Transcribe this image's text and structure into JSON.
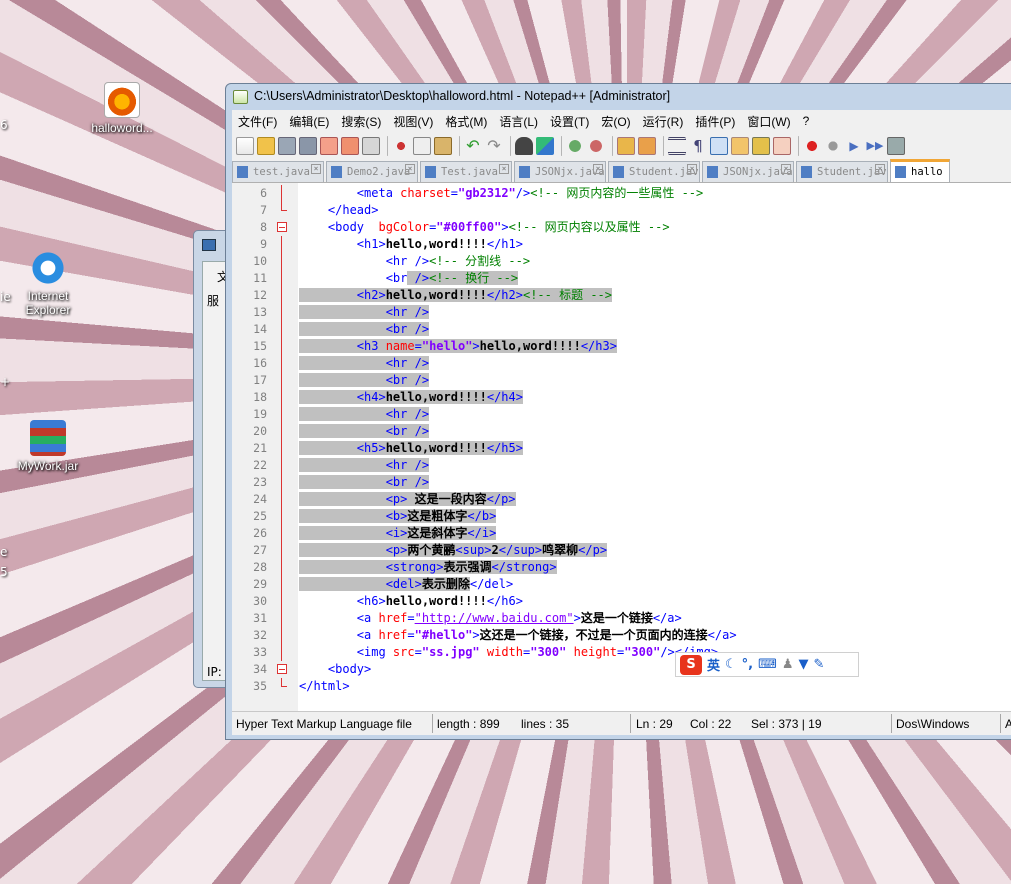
{
  "desktop": {
    "icons": [
      {
        "label": "halloword...",
        "icon": "firefox-html-file-icon"
      },
      {
        "label": "Internet Explorer",
        "icon": "internet-explorer-icon"
      },
      {
        "label": "MyWork.jar",
        "icon": "winrar-archive-icon"
      }
    ],
    "edge_glyphs": [
      "6",
      "ie",
      "+",
      "e",
      "5"
    ]
  },
  "background_window": {
    "chars": [
      "文",
      "服",
      "IP:"
    ]
  },
  "window": {
    "title": "C:\\Users\\Administrator\\Desktop\\halloword.html - Notepad++ [Administrator]"
  },
  "menu": [
    "文件(F)",
    "编辑(E)",
    "搜索(S)",
    "视图(V)",
    "格式(M)",
    "语言(L)",
    "设置(T)",
    "宏(O)",
    "运行(R)",
    "插件(P)",
    "窗口(W)",
    "?"
  ],
  "tabs": [
    {
      "label": "test.java",
      "active": false
    },
    {
      "label": "Demo2.java",
      "active": false
    },
    {
      "label": "Test.java",
      "active": false
    },
    {
      "label": "JSONjx.java",
      "active": false
    },
    {
      "label": "Student.java",
      "active": false
    },
    {
      "label": "JSONjx.java",
      "active": false
    },
    {
      "label": "Student.java",
      "active": false
    },
    {
      "label": "hallo",
      "active": true
    }
  ],
  "code_lines": [
    {
      "n": "6",
      "indent": "        ",
      "sel": false,
      "fold": "line",
      "html": "<span class='t-tag'>&lt;meta </span><span class='t-attr'>charset</span><span class='t-tag'>=</span><span class='t-val'>\"gb2312\"</span><span class='t-tag'>/&gt;</span><span class='t-com'>&lt;!-- 网页内容的一些属性 --&gt;</span>"
    },
    {
      "n": "7",
      "indent": "    ",
      "sel": false,
      "fold": "end",
      "html": "<span class='t-tag'>&lt;/head&gt;</span>"
    },
    {
      "n": "8",
      "indent": "    ",
      "sel": false,
      "fold": "box",
      "html": "<span class='t-tag'>&lt;body  </span><span class='t-attr'>bgColor</span><span class='t-tag'>=</span><span class='t-val'>\"#00ff00\"</span><span class='t-tag'>&gt;</span><span class='t-com'>&lt;!-- 网页内容以及属性 --&gt;</span>"
    },
    {
      "n": "9",
      "indent": "        ",
      "sel": false,
      "fold": "line",
      "html": "<span class='t-tag'>&lt;h1&gt;</span><span class='t-txt'>hello,word!!!!</span><span class='t-tag'>&lt;/h1&gt;</span>"
    },
    {
      "n": "10",
      "indent": "            ",
      "sel": false,
      "fold": "line",
      "html": "<span class='t-tag'>&lt;hr /&gt;</span><span class='t-com'>&lt;!-- 分割线 --&gt;</span>"
    },
    {
      "n": "11",
      "indent": "            ",
      "sel": "partial",
      "fold": "line",
      "pre": "<span class='t-tag'>&lt;br</span>",
      "html": "<span class='t-tag'> /&gt;</span><span class='t-com'>&lt;!-- 换行 --&gt;</span>"
    },
    {
      "n": "12",
      "indent": "        ",
      "sel": true,
      "fold": "line",
      "html": "<span class='t-tag'>&lt;h2&gt;</span><span class='t-txt'>hello,word!!!!</span><span class='t-tag'>&lt;/h2&gt;</span><span class='t-com'>&lt;!-- 标题 --&gt;</span>"
    },
    {
      "n": "13",
      "indent": "            ",
      "sel": true,
      "fold": "line",
      "html": "<span class='t-tag'>&lt;hr /&gt;</span>"
    },
    {
      "n": "14",
      "indent": "            ",
      "sel": true,
      "fold": "line",
      "html": "<span class='t-tag'>&lt;br /&gt;</span>"
    },
    {
      "n": "15",
      "indent": "        ",
      "sel": true,
      "fold": "line",
      "html": "<span class='t-tag'>&lt;h3 </span><span class='t-attr'>name</span><span class='t-tag'>=</span><span class='t-val'>\"hello\"</span><span class='t-tag'>&gt;</span><span class='t-txt'>hello,word!!!!</span><span class='t-tag'>&lt;/h3&gt;</span>"
    },
    {
      "n": "16",
      "indent": "            ",
      "sel": true,
      "fold": "line",
      "html": "<span class='t-tag'>&lt;hr /&gt;</span>"
    },
    {
      "n": "17",
      "indent": "            ",
      "sel": true,
      "fold": "line",
      "html": "<span class='t-tag'>&lt;br /&gt;</span>"
    },
    {
      "n": "18",
      "indent": "        ",
      "sel": true,
      "fold": "line",
      "html": "<span class='t-tag'>&lt;h4&gt;</span><span class='t-txt'>hello,word!!!!</span><span class='t-tag'>&lt;/h4&gt;</span>"
    },
    {
      "n": "19",
      "indent": "            ",
      "sel": true,
      "fold": "line",
      "html": "<span class='t-tag'>&lt;hr /&gt;</span>"
    },
    {
      "n": "20",
      "indent": "            ",
      "sel": true,
      "fold": "line",
      "html": "<span class='t-tag'>&lt;br /&gt;</span>"
    },
    {
      "n": "21",
      "indent": "        ",
      "sel": true,
      "fold": "line",
      "html": "<span class='t-tag'>&lt;h5&gt;</span><span class='t-txt'>hello,word!!!!</span><span class='t-tag'>&lt;/h5&gt;</span>"
    },
    {
      "n": "22",
      "indent": "            ",
      "sel": true,
      "fold": "line",
      "html": "<span class='t-tag'>&lt;hr /&gt;</span>"
    },
    {
      "n": "23",
      "indent": "            ",
      "sel": true,
      "fold": "line",
      "html": "<span class='t-tag'>&lt;br /&gt;</span>"
    },
    {
      "n": "24",
      "indent": "            ",
      "sel": true,
      "fold": "line",
      "html": "<span class='t-tag'>&lt;p&gt;</span><span class='t-txt'> 这是一段内容</span><span class='t-tag'>&lt;/p&gt;</span>"
    },
    {
      "n": "25",
      "indent": "            ",
      "sel": true,
      "fold": "line",
      "html": "<span class='t-tag'>&lt;b&gt;</span><span class='t-txt'>这是粗体字</span><span class='t-tag'>&lt;/b&gt;</span>"
    },
    {
      "n": "26",
      "indent": "            ",
      "sel": true,
      "fold": "line",
      "html": "<span class='t-tag'>&lt;i&gt;</span><span class='t-txt'>这是斜体字</span><span class='t-tag'>&lt;/i&gt;</span>"
    },
    {
      "n": "27",
      "indent": "            ",
      "sel": true,
      "fold": "line",
      "html": "<span class='t-tag'>&lt;p&gt;</span><span class='t-txt'>两个黄鹂</span><span class='t-tag'>&lt;sup&gt;</span><span class='t-txt'>2</span><span class='t-tag'>&lt;/sup&gt;</span><span class='t-txt'>鸣翠柳</span><span class='t-tag'>&lt;/p&gt;</span>"
    },
    {
      "n": "28",
      "indent": "            ",
      "sel": true,
      "fold": "line",
      "html": "<span class='t-tag'>&lt;strong&gt;</span><span class='t-txt'>表示强调</span><span class='t-tag'>&lt;/strong&gt;</span>"
    },
    {
      "n": "29",
      "indent": "            ",
      "sel": "partial-end",
      "fold": "line",
      "pre": "<span class='t-tag'>&lt;del&gt;</span><span class='t-txt'>表示删除</span>",
      "html": "<span class='t-tag'>&lt;/del&gt;</span>"
    },
    {
      "n": "30",
      "indent": "        ",
      "sel": false,
      "fold": "line",
      "html": "<span class='t-tag'>&lt;h6&gt;</span><span class='t-txt'>hello,word!!!!</span><span class='t-tag'>&lt;/h6&gt;</span>"
    },
    {
      "n": "31",
      "indent": "        ",
      "sel": false,
      "fold": "line",
      "html": "<span class='t-tag'>&lt;a </span><span class='t-attr'>href</span><span class='t-tag'>=</span><span class='t-link'>\"http://www.baidu.com\"</span><span class='t-tag'>&gt;</span><span class='t-txt'>这是一个链接</span><span class='t-tag'>&lt;/a&gt;</span>"
    },
    {
      "n": "32",
      "indent": "        ",
      "sel": false,
      "fold": "line",
      "html": "<span class='t-tag'>&lt;a </span><span class='t-attr'>href</span><span class='t-tag'>=</span><span class='t-val'>\"#hello\"</span><span class='t-tag'>&gt;</span><span class='t-txt'>这还是一个链接，不过是一个页面内的连接</span><span class='t-tag'>&lt;/a&gt;</span>"
    },
    {
      "n": "33",
      "indent": "        ",
      "sel": false,
      "fold": "line",
      "html": "<span class='t-tag'>&lt;img </span><span class='t-attr'>src</span><span class='t-tag'>=</span><span class='t-val'>\"ss.jpg\"</span><span class='t-tag'> </span><span class='t-attr'>width</span><span class='t-tag'>=</span><span class='t-val'>\"300\"</span><span class='t-tag'> </span><span class='t-attr'>height</span><span class='t-tag'>=</span><span class='t-val'>\"300\"</span><span class='t-tag'>/&gt;&lt;/img&gt;</span>"
    },
    {
      "n": "34",
      "indent": "    ",
      "sel": false,
      "fold": "box",
      "html": "<span class='t-tag'>&lt;body&gt;</span>"
    },
    {
      "n": "35",
      "indent": "",
      "sel": false,
      "fold": "end",
      "html": "<span class='t-tag'>&lt;/html&gt;</span>"
    }
  ],
  "status": {
    "file_type": "Hyper Text Markup Language file",
    "length": "length : 899",
    "lines": "lines : 35",
    "ln": "Ln : 29",
    "col": "Col : 22",
    "sel": "Sel : 373 | 19",
    "eol": "Dos\\Windows",
    "enc": "A"
  },
  "ime": {
    "logo": "S",
    "mode": "英"
  },
  "colors": {
    "tag": "#0000ff",
    "attr": "#ff0000",
    "value": "#8000ff",
    "comment": "#008000",
    "selection": "#c0c0c0",
    "active_tab_accent": "#f1a636"
  }
}
